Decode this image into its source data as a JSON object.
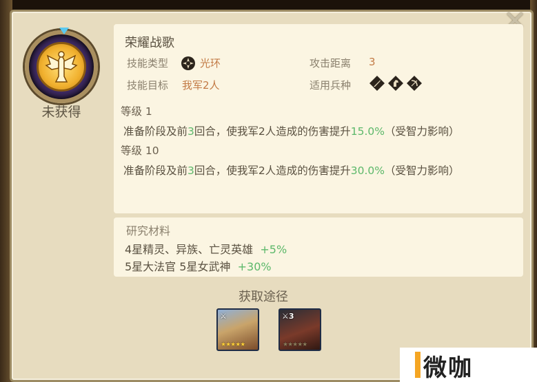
{
  "skill": {
    "name": "荣耀战歌",
    "status": "未获得",
    "type_label": "技能类型",
    "type_value": "光环",
    "range_label": "攻击距离",
    "range_value": "3",
    "target_label": "技能目标",
    "target_value": "我军2人",
    "troop_label": "适用兵种",
    "troop_icons": [
      "sword-icon",
      "horse-icon",
      "bow-icon"
    ]
  },
  "levels": [
    {
      "label": "等级 1",
      "pre": "准备阶段及前",
      "rounds": "3",
      "mid": "回合，使我军2人造成的伤害提升",
      "pct": "15.0%",
      "post": "（受智力影响）"
    },
    {
      "label": "等级 10",
      "pre": "准备阶段及前",
      "rounds": "3",
      "mid": "回合，使我军2人造成的伤害提升",
      "pct": "30.0%",
      "post": "（受智力影响）"
    }
  ],
  "materials": {
    "header": "研究材料",
    "rows": [
      {
        "text": "4星精灵、异族、亡灵英雄",
        "bonus": "+5%"
      },
      {
        "text": "5星大法官 5星女武神",
        "bonus": "+30%"
      }
    ]
  },
  "sources": {
    "header": "获取途径",
    "heroes": [
      {
        "badge": "",
        "stars": "★★★★★",
        "stars_dim": false
      },
      {
        "badge": "3",
        "stars": "★★★★★",
        "stars_dim": true
      }
    ]
  },
  "watermark": "微咖",
  "colors": {
    "accent_green": "#5cb86a",
    "value_orange": "#c27a45",
    "panel_bg": "#e7dcbf",
    "card_bg": "#fbf5e2"
  }
}
